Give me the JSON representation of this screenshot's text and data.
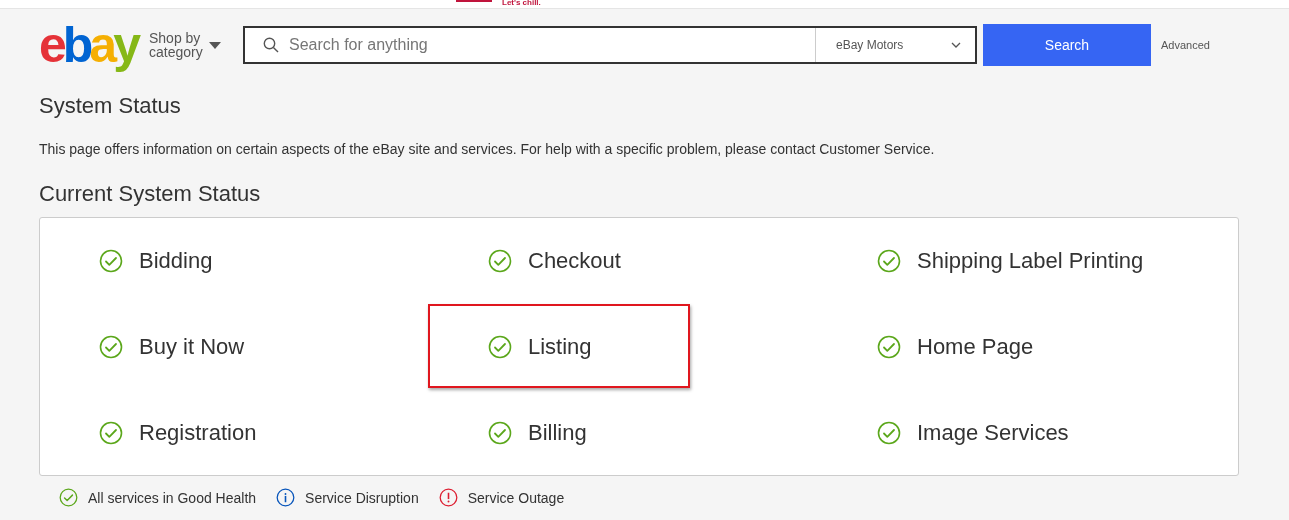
{
  "ad_strip": {
    "text": "Let's chill."
  },
  "header": {
    "logo": [
      "e",
      "b",
      "a",
      "y"
    ],
    "shop_by_category": "Shop by category",
    "search": {
      "placeholder": "Search for anything"
    },
    "category": "eBay Motors",
    "search_button": "Search",
    "advanced": "Advanced"
  },
  "page_title": "System Status",
  "intro": "This page offers information on certain aspects of the eBay site and services. For help with a specific problem, please contact Customer Service.",
  "section_title": "Current System Status",
  "services": [
    {
      "name": "Bidding",
      "kind": "good",
      "highlighted": false
    },
    {
      "name": "Checkout",
      "kind": "good",
      "highlighted": false
    },
    {
      "name": "Shipping Label Printing",
      "kind": "good",
      "highlighted": false
    },
    {
      "name": "Buy it Now",
      "kind": "good",
      "highlighted": false
    },
    {
      "name": "Listing",
      "kind": "good",
      "highlighted": true
    },
    {
      "name": "Home Page",
      "kind": "good",
      "highlighted": false
    },
    {
      "name": "Registration",
      "kind": "good",
      "highlighted": false
    },
    {
      "name": "Billing",
      "kind": "good",
      "highlighted": false
    },
    {
      "name": "Image Services",
      "kind": "good",
      "highlighted": false
    }
  ],
  "legend": [
    {
      "label": "All services in Good Health",
      "kind": "good"
    },
    {
      "label": "Service Disruption",
      "kind": "disruption"
    },
    {
      "label": "Service Outage",
      "kind": "outage"
    }
  ]
}
